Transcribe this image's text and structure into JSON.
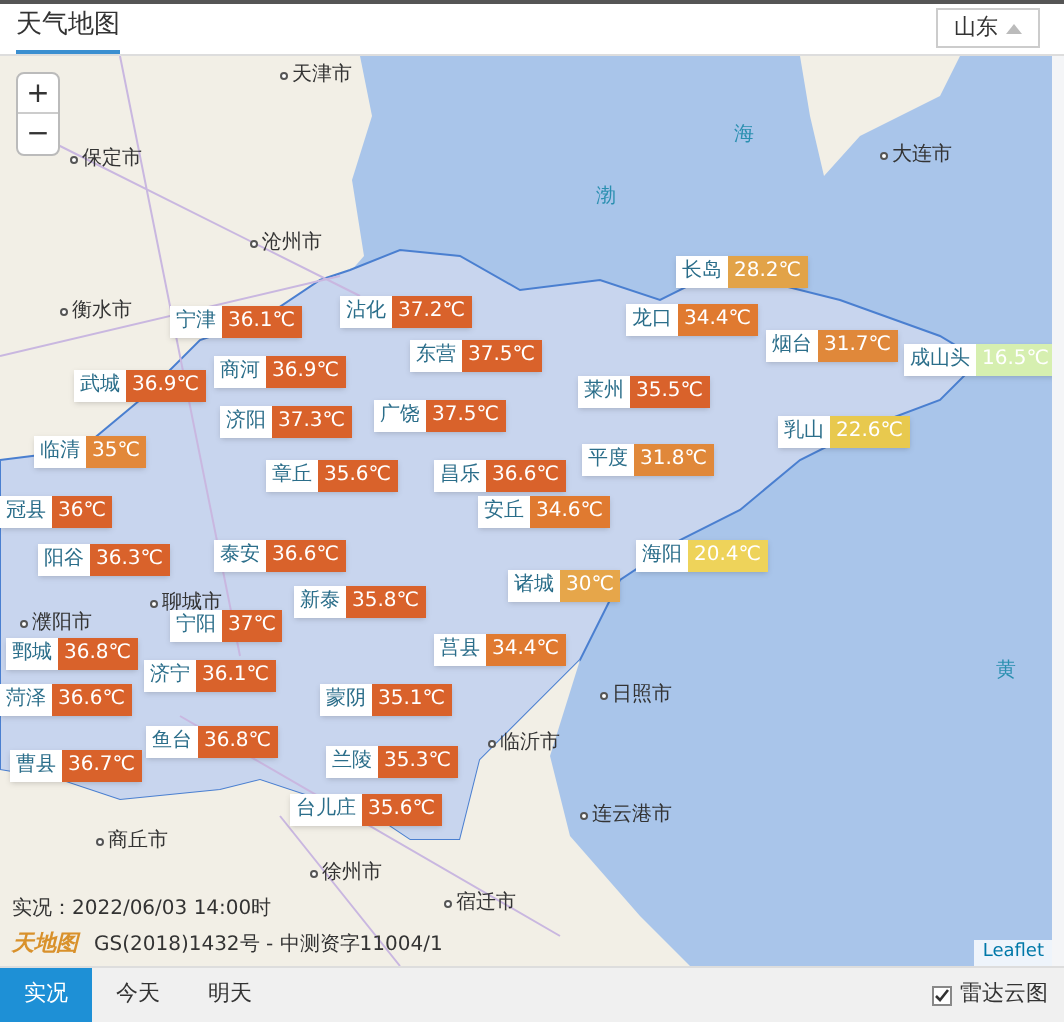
{
  "header": {
    "title": "天气地图",
    "region_select": {
      "value": "山东"
    }
  },
  "stations": [
    {
      "name": "宁津",
      "temp": "36.1℃",
      "color": "#d9622b"
    },
    {
      "name": "沾化",
      "temp": "37.2℃",
      "color": "#d9622b"
    },
    {
      "name": "长岛",
      "temp": "28.2℃",
      "color": "#e2a348"
    },
    {
      "name": "龙口",
      "temp": "34.4℃",
      "color": "#e07a30"
    },
    {
      "name": "东营",
      "temp": "37.5℃",
      "color": "#d9622b"
    },
    {
      "name": "烟台",
      "temp": "31.7℃",
      "color": "#e0883a"
    },
    {
      "name": "成山头",
      "temp": "16.5℃",
      "color": "#d6efb0"
    },
    {
      "name": "商河",
      "temp": "36.9℃",
      "color": "#d9622b"
    },
    {
      "name": "武城",
      "temp": "36.9℃",
      "color": "#d9622b"
    },
    {
      "name": "莱州",
      "temp": "35.5℃",
      "color": "#d9622b"
    },
    {
      "name": "济阳",
      "temp": "37.3℃",
      "color": "#d9622b"
    },
    {
      "name": "广饶",
      "temp": "37.5℃",
      "color": "#d9622b"
    },
    {
      "name": "临清",
      "temp": "35℃",
      "color": "#e2883a"
    },
    {
      "name": "乳山",
      "temp": "22.6℃",
      "color": "#e8c94e"
    },
    {
      "name": "章丘",
      "temp": "35.6℃",
      "color": "#d9622b"
    },
    {
      "name": "昌乐",
      "temp": "36.6℃",
      "color": "#d9622b"
    },
    {
      "name": "平度",
      "temp": "31.8℃",
      "color": "#e0883a"
    },
    {
      "name": "冠县",
      "temp": "36℃",
      "color": "#d9622b"
    },
    {
      "name": "安丘",
      "temp": "34.6℃",
      "color": "#e07a30"
    },
    {
      "name": "阳谷",
      "temp": "36.3℃",
      "color": "#d9622b"
    },
    {
      "name": "泰安",
      "temp": "36.6℃",
      "color": "#d9622b"
    },
    {
      "name": "海阳",
      "temp": "20.4℃",
      "color": "#eed35a"
    },
    {
      "name": "诸城",
      "temp": "30℃",
      "color": "#e6a64a"
    },
    {
      "name": "新泰",
      "temp": "35.8℃",
      "color": "#d9622b"
    },
    {
      "name": "宁阳",
      "temp": "37℃",
      "color": "#d9622b"
    },
    {
      "name": "鄄城",
      "temp": "36.8℃",
      "color": "#d9622b"
    },
    {
      "name": "莒县",
      "temp": "34.4℃",
      "color": "#e07a30"
    },
    {
      "name": "济宁",
      "temp": "36.1℃",
      "color": "#d9622b"
    },
    {
      "name": "菏泽",
      "temp": "36.6℃",
      "color": "#d9622b"
    },
    {
      "name": "蒙阴",
      "temp": "35.1℃",
      "color": "#d9622b"
    },
    {
      "name": "鱼台",
      "temp": "36.8℃",
      "color": "#d9622b"
    },
    {
      "name": "曹县",
      "temp": "36.7℃",
      "color": "#d9622b"
    },
    {
      "name": "兰陵",
      "temp": "35.3℃",
      "color": "#d9622b"
    },
    {
      "name": "台儿庄",
      "temp": "35.6℃",
      "color": "#d9622b"
    }
  ],
  "map_labels": [
    "天津市",
    "保定市",
    "大连市",
    "沧州市",
    "衡水市",
    "聊城市",
    "日照市",
    "临沂市",
    "濮阳市",
    "连云港市",
    "商丘市",
    "徐州市",
    "宿迁市",
    "渤",
    "海",
    "黄"
  ],
  "map_info": {
    "time": "实况：2022/06/03 14:00时",
    "logo": "天地图",
    "license": "GS(2018)1432号 - 中测资字11004/1",
    "attribution": "Leaflet"
  },
  "zoom": {
    "in": "+",
    "out": "−"
  },
  "tabs": [
    {
      "label": "实况",
      "selected": true
    },
    {
      "label": "今天",
      "selected": false
    },
    {
      "label": "明天",
      "selected": false
    }
  ],
  "overlay": {
    "label": "雷达云图",
    "checked": true
  }
}
